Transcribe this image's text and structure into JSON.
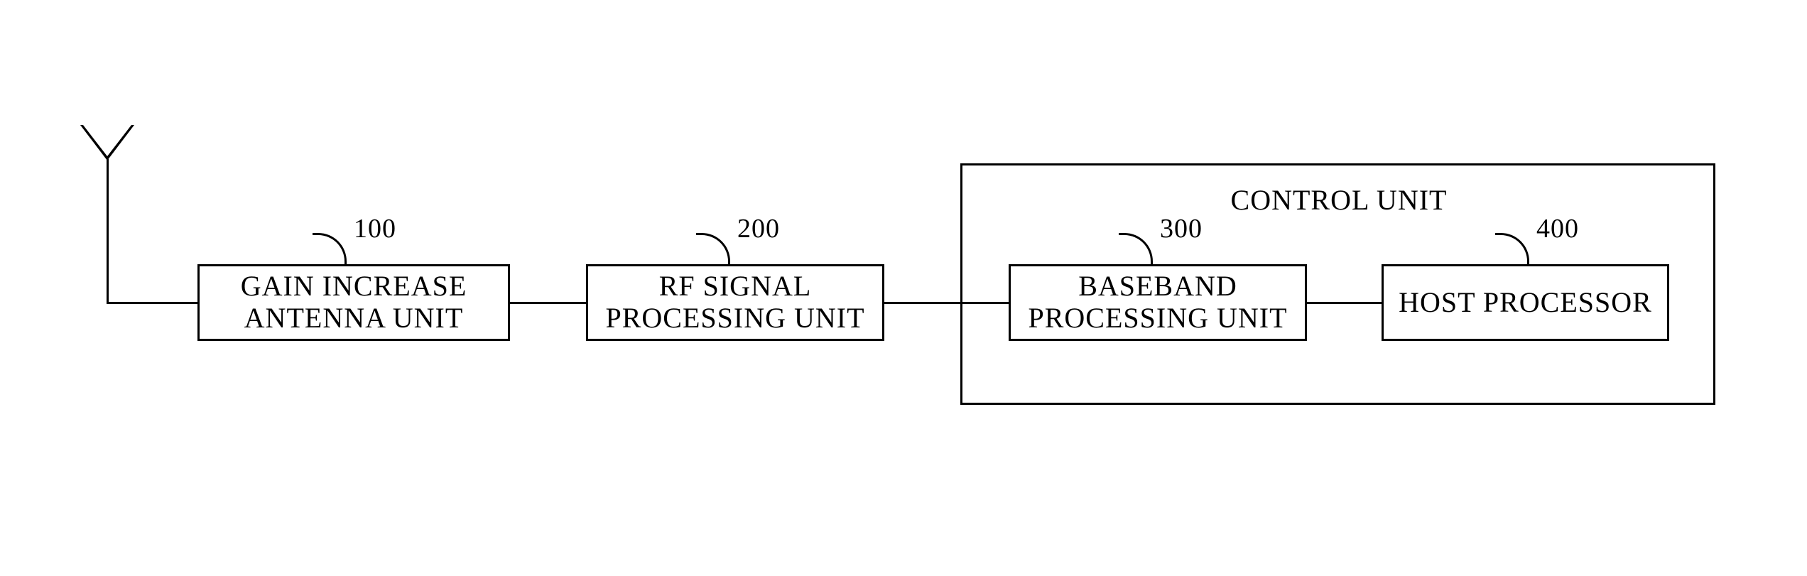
{
  "blocks": {
    "gain_increase_antenna_unit": {
      "label": "GAIN INCREASE\nANTENNA UNIT",
      "ref": "100"
    },
    "rf_signal_processing_unit": {
      "label": "RF SIGNAL\nPROCESSING UNIT",
      "ref": "200"
    },
    "baseband_processing_unit": {
      "label": "BASEBAND\nPROCESSING UNIT",
      "ref": "300"
    },
    "host_processor": {
      "label": "HOST PROCESSOR",
      "ref": "400"
    }
  },
  "control_unit": {
    "title": "CONTROL UNIT"
  }
}
